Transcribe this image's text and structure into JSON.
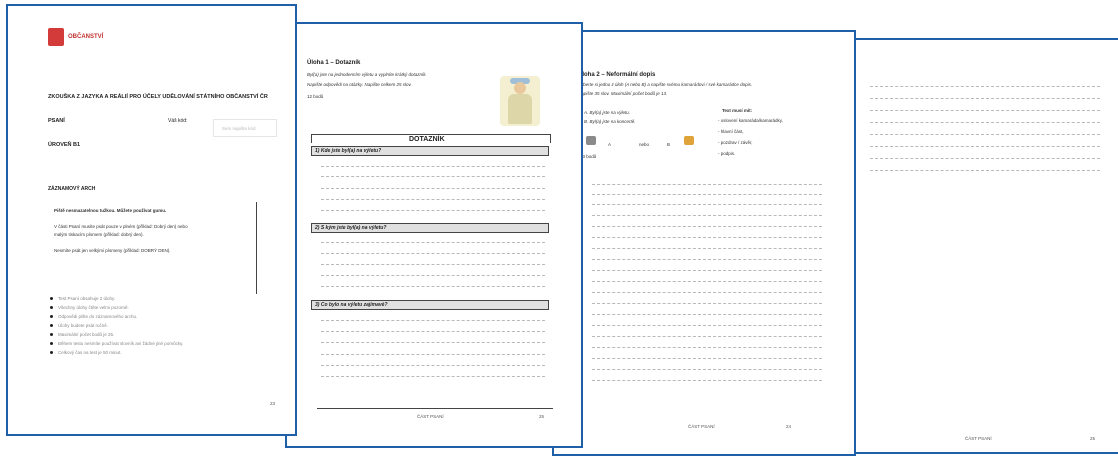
{
  "page1": {
    "brand": "OBČANSTVÍ",
    "exam_title": "ZKOUŠKA Z JAZYKA A REÁLIÍ PRO ÚČELY UDĚLOVÁNÍ STÁTNÍHO OBČANSTVÍ ČR",
    "section_label": "PSANÍ",
    "code_label": "Váš kód:",
    "code_placeholder": "Sem napište kód",
    "level_label": "ÚROVEŇ B1",
    "answer_sheet": "ZÁZNAMOVÝ ARCH",
    "rule_1": "Piště nesmazatelnou tužkou. Můžete používat gumu.",
    "rule_2a": "V části Psaní musíte psát pouze v plném (příklad: Dobrý den) nebo",
    "rule_2b": "malým tiskacím písmem (příklad: dobrý den).",
    "rule_3": "Nesmíte psát jen velkými písmeny (příklad: DOBRÝ DEN).",
    "bullets": [
      "Test Psaní obsahuje 2 úlohy.",
      "Všechny úlohy čtěte velmi pozorně.",
      "Odpovědi pište do záznamového archu.",
      "Úlohy budete psát ručně.",
      "Maximální počet bodů je 25.",
      "Během testu nesmíte používat slovník ani žádné jiné pomůcky.",
      "Celkový čas na test je 50 minut."
    ],
    "page_number": "23"
  },
  "page2": {
    "task_title": "Úloha 1 – Dotazník",
    "instruction_1": "Byl(a) jste na jednodenním výletu a vyplníte krátký dotazník.",
    "instruction_2": "Napište odpovědi na otázky. Napište celkem 25 slov.",
    "points": "12 bodů",
    "form_title": "DOTAZNÍK",
    "questions": [
      "1) Kde jste byl(a) na výletu?",
      "2) S kým jste byl(a) na výletu?",
      "3) Co bylo na výletu zajímavé?"
    ],
    "footer": "ČÁST PSANÍ",
    "page_number": "25"
  },
  "page3": {
    "task_title": "Úloha 2 – Neformální dopis",
    "instruction_1": "Vyberte si jednu z úloh (A nebo B) a napište svému kamarádovi / své kamarádce dopis.",
    "instruction_2": "Napište 35 slov. Maximální počet bodů je 13.",
    "option_a": "A. Byl(a) jste na výletu.",
    "option_b": "B. Byl(a) jste na koncertě.",
    "choice_a": "A",
    "choice_or": "nebo",
    "choice_b": "B",
    "points": "13 bodů",
    "must_header": "Text musí mít:",
    "must_items": [
      "- oslovení kamaráda/kamarádky,",
      "- hlavní část,",
      "- pozdrav / závěr,",
      "- podpis."
    ],
    "footer": "ČÁST PSANÍ",
    "page_number": "24"
  },
  "page4": {
    "footer": "ČÁST PSANÍ",
    "page_number": "25"
  },
  "colors": {
    "border": "#1f5fa8",
    "brand": "#c0312f"
  }
}
